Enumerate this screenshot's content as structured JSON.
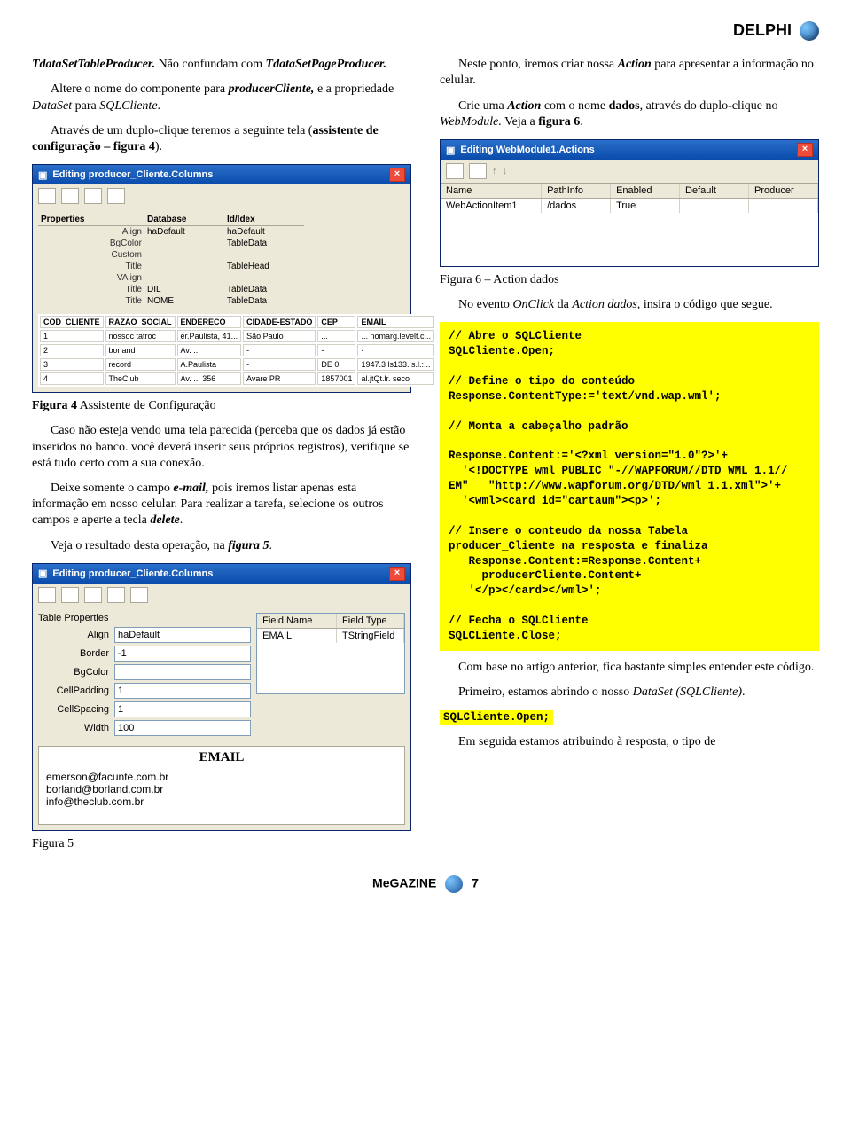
{
  "header": "DELPHI",
  "left": {
    "p1_a": "TdataSetTableProducer.",
    "p1_b": " Não confundam com ",
    "p1_c": "TdataSetPageProducer.",
    "p2_pre": "Altere o nome do componente para ",
    "p2_b": "producerCliente,",
    "p2_mid": " e a propriedade ",
    "p2_i1": "DataSet",
    "p2_mid2": " para ",
    "p2_i2": "SQLCliente",
    "p2_end": ".",
    "p3_pre": "Através de um duplo-clique teremos a seguinte tela (",
    "p3_b": "assistente de configuração – figura 4",
    "p3_end": ").",
    "fig4": {
      "title": "Editing producer_Cliente.Columns",
      "tabs": {
        "label": "Properties",
        "val1": "Database",
        "val2": "Id/Idex"
      },
      "rows": [
        [
          "Align",
          "haDefault",
          "haDefault"
        ],
        [
          "BgColor",
          "",
          "TableData"
        ],
        [
          "Custom",
          "",
          ""
        ],
        [
          "Title",
          "",
          "TableHead"
        ],
        [
          "VAlign",
          "",
          ""
        ],
        [
          "Title",
          "DIL",
          "TableData"
        ],
        [
          "Title",
          "NOME",
          "TableData"
        ]
      ],
      "tableHeaders": [
        "COD_CLIENTE",
        "RAZAO_SOCIAL",
        "ENDERECO",
        "CIDADE-ESTADO",
        "CEP",
        "EMAIL"
      ],
      "tableRows": [
        [
          "1",
          "nossoc tatroc",
          "er.Paulista, 41...",
          "São Paulo",
          "...",
          "... nomarg.levelt.c..."
        ],
        [
          "2",
          "borland",
          "Av. ...",
          "-",
          "-",
          "-"
        ],
        [
          "3",
          "record",
          "A.Paulista",
          "-",
          "DE  0",
          "1947.3 ls133. s.l.:..."
        ],
        [
          "4",
          "TheClub",
          "Av. ... 356",
          "Avare   PR",
          "1857001",
          "al.jtQt.lr. seco"
        ]
      ],
      "caption_b": "Figura 4",
      "caption_rest": " Assistente de Configuração"
    },
    "p4": "Caso não esteja vendo uma tela parecida (perceba que os dados já estão inseridos no banco. você deverá inserir seus próprios registros), verifique se está tudo certo com a sua conexão.",
    "p5_pre": "Deixe somente o campo ",
    "p5_b1": "e-mail,",
    "p5_mid": " pois iremos listar apenas esta informação em nosso celular. Para realizar a tarefa, selecione os outros campos e aperte a tecla ",
    "p5_b2": "delete",
    "p5_end": ".",
    "p6_pre": "Veja o resultado desta operação, na ",
    "p6_b": "figura 5",
    "p6_end": ".",
    "fig5": {
      "title": "Editing producer_Cliente.Columns",
      "section": "Table Properties",
      "fields": {
        "align_lbl": "Align",
        "align_val": "haDefault",
        "border_lbl": "Border",
        "border_val": "-1",
        "bgcolor_lbl": "BgColor",
        "bgcolor_val": "",
        "cellpadding_lbl": "CellPadding",
        "cellpadding_val": "1",
        "cellspacing_lbl": "CellSpacing",
        "cellspacing_val": "1",
        "width_lbl": "Width",
        "width_val": "100"
      },
      "right_headers": [
        "Field Name",
        "Field Type"
      ],
      "right_row": [
        "EMAIL",
        "TStringField"
      ],
      "email_head": "EMAIL",
      "emails": [
        "emerson@facunte.com.br",
        "borland@borland.com.br",
        "info@theclub.com.br"
      ],
      "caption": "Figura 5"
    }
  },
  "right": {
    "p1_pre": "Neste ponto, iremos criar nossa ",
    "p1_b": "Action",
    "p1_end": " para apresentar a informação no celular.",
    "p2_pre": "Crie uma ",
    "p2_b1": "Action",
    "p2_mid1": " com o nome ",
    "p2_b2": "dados",
    "p2_mid2": ", através do duplo-clique no ",
    "p2_i": "WebModule.",
    "p2_mid3": " Veja a ",
    "p2_b3": "figura 6",
    "p2_end": ".",
    "fig6": {
      "title": "Editing WebModule1.Actions",
      "headers": [
        "Name",
        "PathInfo",
        "Enabled",
        "Default",
        "Producer"
      ],
      "row": [
        "WebActionItem1",
        "/dados",
        "True",
        "",
        ""
      ],
      "caption": "Figura 6 – Action dados"
    },
    "p3_pre": "No evento ",
    "p3_i1": "OnClick",
    "p3_mid": " da ",
    "p3_i2": "Action dados,",
    "p3_end": " insira o código que segue.",
    "code": "// Abre o SQLCliente\nSQLCliente.Open;\n\n// Define o tipo do conteúdo\nResponse.ContentType:='text/vnd.wap.wml';\n\n// Monta a cabeçalho padrão\n\nResponse.Content:='<?xml version=\"1.0\"?>'+\n  '<!DOCTYPE wml PUBLIC \"-//WAPFORUM//DTD WML 1.1//\nEM\"   \"http://www.wapforum.org/DTD/wml_1.1.xml\">'+\n  '<wml><card id=\"cartaum\"><p>';\n\n// Insere o conteudo da nossa Tabela\nproducer_Cliente na resposta e finaliza\n   Response.Content:=Response.Content+\n     producerCliente.Content+\n   '</p></card></wml>';\n\n// Fecha o SQLCliente\nSQLCLiente.Close;",
    "p4": "Com base no artigo anterior, fica bastante simples entender este código.",
    "p5_pre": "Primeiro, estamos abrindo o nosso ",
    "p5_i": "DataSet (SQLCliente)",
    "p5_end": ".",
    "code2": "SQLCliente.Open;",
    "p6": "Em seguida estamos atribuindo à resposta, o tipo de"
  },
  "footer": {
    "mag": "MeGAZINE",
    "page": "7"
  }
}
